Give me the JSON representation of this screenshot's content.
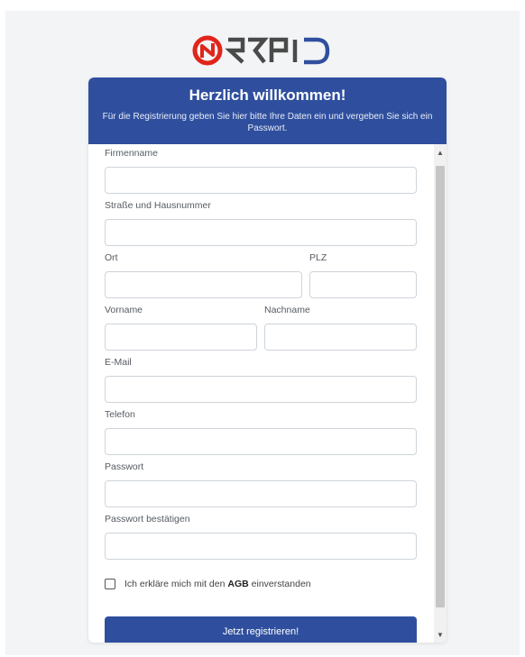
{
  "brand": {
    "logo_text": "RAPID",
    "logo_ring_color": "#e1251b",
    "logo_letter_color": "#4a4a4a",
    "logo_d_color": "#2f4f9e"
  },
  "header": {
    "title": "Herzlich willkommen!",
    "subtitle": "Für die Registrierung geben Sie hier bitte Ihre Daten ein und vergeben Sie sich ein Passwort."
  },
  "form": {
    "company": {
      "label": "Firmenname",
      "value": ""
    },
    "street": {
      "label": "Straße und Hausnummer",
      "value": ""
    },
    "city": {
      "label": "Ort",
      "value": ""
    },
    "zip": {
      "label": "PLZ",
      "value": ""
    },
    "firstname": {
      "label": "Vorname",
      "value": ""
    },
    "lastname": {
      "label": "Nachname",
      "value": ""
    },
    "email": {
      "label": "E-Mail",
      "value": ""
    },
    "phone": {
      "label": "Telefon",
      "value": ""
    },
    "password": {
      "label": "Passwort",
      "value": ""
    },
    "password_confirm": {
      "label": "Passwort bestätigen",
      "value": ""
    },
    "terms": {
      "prefix": "Ich erkläre mich mit den",
      "highlight": "AGB",
      "suffix": "einverstanden",
      "checked": false
    },
    "submit_label": "Jetzt registrieren!"
  },
  "scrollbar": {
    "up_arrow": "▲",
    "down_arrow": "▼"
  },
  "colors": {
    "primary": "#2f4f9e",
    "page_bg": "#f3f4f6"
  }
}
